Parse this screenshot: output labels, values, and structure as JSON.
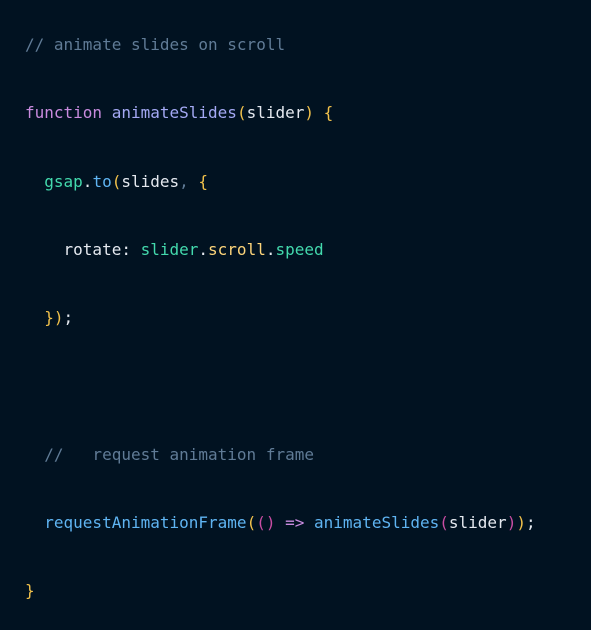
{
  "colors": {
    "background": "#011221",
    "comment": "#607b96",
    "keyword": "#c98bdf",
    "function_name": "#a4a9f4",
    "identifier": "#e5e9f0",
    "property": "#43d9ad",
    "method": "#fcd47a",
    "bracket": "#f1c14b",
    "bracket_inner": "#c84da3",
    "operator": "#c98bdf",
    "call": "#5fb4f2"
  },
  "code": {
    "lines": [
      {
        "tokens": [
          {
            "text": "// animate slides on scroll",
            "role": "comment"
          }
        ]
      },
      {
        "tokens": [
          {
            "text": "function",
            "role": "keyword"
          },
          {
            "text": " ",
            "role": "identifier"
          },
          {
            "text": "animateSlides",
            "role": "function_name"
          },
          {
            "text": "(",
            "role": "bracket"
          },
          {
            "text": "slider",
            "role": "identifier"
          },
          {
            "text": ")",
            "role": "bracket"
          },
          {
            "text": " ",
            "role": "identifier"
          },
          {
            "text": "{",
            "role": "bracket"
          }
        ]
      },
      {
        "tokens": [
          {
            "text": "  ",
            "role": "identifier"
          },
          {
            "text": "gsap",
            "role": "property"
          },
          {
            "text": ".",
            "role": "identifier"
          },
          {
            "text": "to",
            "role": "call"
          },
          {
            "text": "(",
            "role": "bracket"
          },
          {
            "text": "slides",
            "role": "identifier"
          },
          {
            "text": ", ",
            "role": "comment"
          },
          {
            "text": "{",
            "role": "bracket"
          }
        ]
      },
      {
        "tokens": [
          {
            "text": "    ",
            "role": "identifier"
          },
          {
            "text": "rotate",
            "role": "identifier"
          },
          {
            "text": ": ",
            "role": "identifier"
          },
          {
            "text": "slider",
            "role": "property"
          },
          {
            "text": ".",
            "role": "identifier"
          },
          {
            "text": "scroll",
            "role": "method"
          },
          {
            "text": ".",
            "role": "identifier"
          },
          {
            "text": "speed",
            "role": "property"
          }
        ]
      },
      {
        "tokens": [
          {
            "text": "  ",
            "role": "identifier"
          },
          {
            "text": "})",
            "role": "bracket"
          },
          {
            "text": ";",
            "role": "identifier"
          }
        ]
      },
      {
        "tokens": [
          {
            "text": "  ",
            "role": "identifier"
          },
          {
            "text": "//   request animation frame",
            "role": "comment"
          }
        ]
      },
      {
        "tokens": [
          {
            "text": "  ",
            "role": "identifier"
          },
          {
            "text": "requestAnimationFrame",
            "role": "call"
          },
          {
            "text": "(",
            "role": "bracket"
          },
          {
            "text": "()",
            "role": "bracket_inner"
          },
          {
            "text": " ",
            "role": "identifier"
          },
          {
            "text": "=>",
            "role": "operator"
          },
          {
            "text": " ",
            "role": "identifier"
          },
          {
            "text": "animateSlides",
            "role": "call"
          },
          {
            "text": "(",
            "role": "bracket_inner"
          },
          {
            "text": "slider",
            "role": "identifier"
          },
          {
            "text": ")",
            "role": "bracket_inner"
          },
          {
            "text": ")",
            "role": "bracket"
          },
          {
            "text": ";",
            "role": "identifier"
          }
        ]
      },
      {
        "tokens": [
          {
            "text": "}",
            "role": "bracket"
          }
        ]
      }
    ]
  }
}
